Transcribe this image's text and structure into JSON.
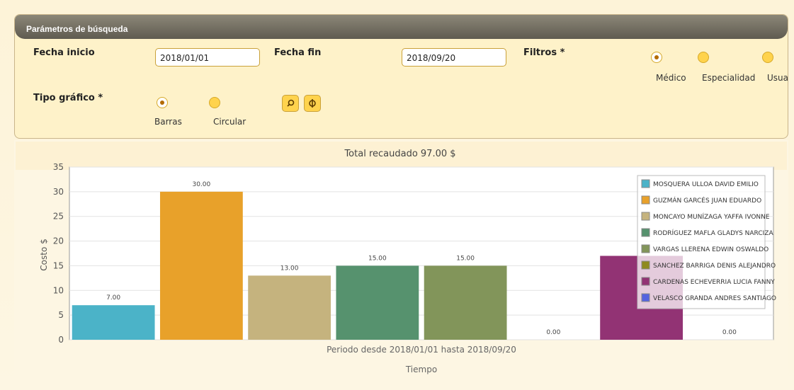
{
  "panel": {
    "title": "Parámetros de búsqueda",
    "fecha_inicio_label": "Fecha inicio",
    "fecha_inicio_value": "2018/01/01",
    "fecha_fin_label": "Fecha fin",
    "fecha_fin_value": "2018/09/20",
    "filtros_label": "Filtros *",
    "filtros_options": [
      "Médico",
      "Especialidad",
      "Usuari"
    ],
    "filtros_selected": "Médico",
    "tipo_label": "Tipo gráfico *",
    "tipo_options": [
      "Barras",
      "Circular"
    ],
    "tipo_selected": "Barras",
    "search_icon": "search-icon",
    "refresh_icon": "refresh-icon"
  },
  "chart_data": {
    "type": "bar",
    "title": "Total recaudado 97.00 $",
    "xlabel": "Tiempo",
    "subtitle": "Periodo desde 2018/01/01 hasta 2018/09/20",
    "ylabel": "Costo $",
    "ylim": [
      0,
      35
    ],
    "yticks": [
      0,
      5,
      10,
      15,
      20,
      25,
      30,
      35
    ],
    "grid": true,
    "legend_position": "top-right",
    "series": [
      {
        "name": "MOSQUERA ULLOA DAVID EMILIO",
        "value": 7,
        "label": "7.00",
        "color": "#4bb3c8"
      },
      {
        "name": "GUZMÁN GARCÉS JUAN EDUARDO",
        "value": 30,
        "label": "30.00",
        "color": "#e8a12a"
      },
      {
        "name": "MONCAYO MUNÍZAGA YAFFA IVONNE",
        "value": 13,
        "label": "13.00",
        "color": "#c5b37e"
      },
      {
        "name": "RODRÍGUEZ MAFLA GLADYS NARCIZA",
        "value": 15,
        "label": "15.00",
        "color": "#56926e"
      },
      {
        "name": "VARGAS LLERENA EDWIN OSWALDO",
        "value": 15,
        "label": "15.00",
        "color": "#82955a"
      },
      {
        "name": "SANCHEZ BARRIGA DENIS ALEJANDRO",
        "value": 0,
        "label": "0.00",
        "color": "#8f8a1f"
      },
      {
        "name": "CARDENAS ECHEVERRIA LUCIA FANNY",
        "value": 17,
        "label": "",
        "color": "#923374"
      },
      {
        "name": "VELASCO GRANDA ANDRES SANTIAGO",
        "value": 0,
        "label": "0.00",
        "color": "#5463e0"
      }
    ]
  }
}
